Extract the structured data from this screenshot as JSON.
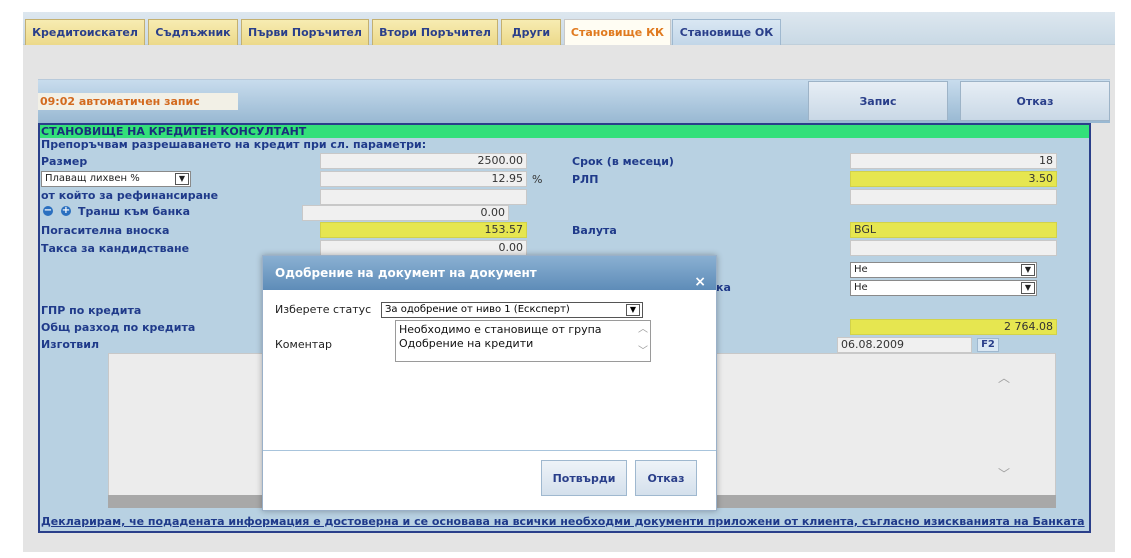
{
  "tabs": [
    {
      "label": "Кредитоискател"
    },
    {
      "label": "Съдлъжник"
    },
    {
      "label": "Първи Поръчител"
    },
    {
      "label": "Втори Поръчител"
    },
    {
      "label": "Други"
    },
    {
      "label": "Становище КК"
    },
    {
      "label": "Становище ОК"
    }
  ],
  "topbar": {
    "autosave": "09:02 автоматичен запис",
    "save_label": "Запис",
    "cancel_label": "Отказ"
  },
  "panel": {
    "title": "СТАНОВИЩЕ НА КРЕДИТЕН КОНСУЛТАНТ",
    "subtitle": "Препоръчвам разрешаването на кредит при сл. параметри:",
    "size_label": "Размер",
    "size_value": "2500.00",
    "rate_type": "Плаващ лихвен %",
    "rate_value": "12.95",
    "rate_unit": "%",
    "refinance_label": "от който за рефинансиране",
    "tranche_label": "Транш към банка",
    "tranche_value": "0.00",
    "installment_label": "Погасителна вноска",
    "installment_value": "153.57",
    "fee_label": "Такса за кандидстване",
    "fee_value": "0.00",
    "term_label": "Срок (в месеци)",
    "term_value": "18",
    "rlp_label": "РЛП",
    "rlp_value": "3.50",
    "currency_label": "Валута",
    "currency_value": "BGL",
    "select1_value": "Не",
    "select2_label": "ка",
    "select2_value": "Не",
    "gpr_label": "ГПР по кредита",
    "total_cost_label": "Общ разход по кредита",
    "total_cost_value": "2 764.08",
    "prepared_label": "Изготвил",
    "date_value": "06.08.2009",
    "f2_label": "F2",
    "footer": "Декларирам, че подадената информация е достоверна и се основава на всички необходми документи приложени от клиента, съгласно изискванията на Банката"
  },
  "modal": {
    "title": "Одобрение на документ на документ",
    "close": "×",
    "status_label": "Изберете статус",
    "status_value": "За одобрение от ниво 1 (Есксперт)",
    "comment_label": "Коментар",
    "comment_value": "Необходимо е становище от група Одобрение на кредити",
    "confirm_label": "Потвърди",
    "cancel_label": "Отказ"
  }
}
